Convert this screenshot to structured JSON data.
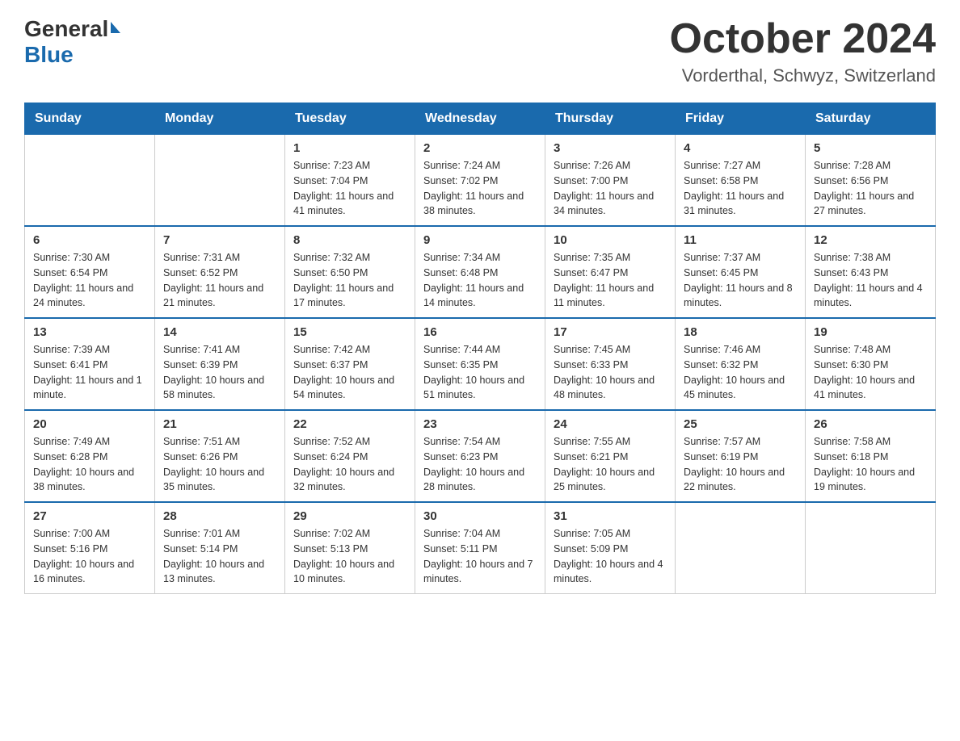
{
  "header": {
    "logo_general": "General",
    "logo_blue": "Blue",
    "month_title": "October 2024",
    "location": "Vorderthal, Schwyz, Switzerland"
  },
  "weekdays": [
    "Sunday",
    "Monday",
    "Tuesday",
    "Wednesday",
    "Thursday",
    "Friday",
    "Saturday"
  ],
  "weeks": [
    [
      {
        "day": "",
        "sunrise": "",
        "sunset": "",
        "daylight": ""
      },
      {
        "day": "",
        "sunrise": "",
        "sunset": "",
        "daylight": ""
      },
      {
        "day": "1",
        "sunrise": "Sunrise: 7:23 AM",
        "sunset": "Sunset: 7:04 PM",
        "daylight": "Daylight: 11 hours and 41 minutes."
      },
      {
        "day": "2",
        "sunrise": "Sunrise: 7:24 AM",
        "sunset": "Sunset: 7:02 PM",
        "daylight": "Daylight: 11 hours and 38 minutes."
      },
      {
        "day": "3",
        "sunrise": "Sunrise: 7:26 AM",
        "sunset": "Sunset: 7:00 PM",
        "daylight": "Daylight: 11 hours and 34 minutes."
      },
      {
        "day": "4",
        "sunrise": "Sunrise: 7:27 AM",
        "sunset": "Sunset: 6:58 PM",
        "daylight": "Daylight: 11 hours and 31 minutes."
      },
      {
        "day": "5",
        "sunrise": "Sunrise: 7:28 AM",
        "sunset": "Sunset: 6:56 PM",
        "daylight": "Daylight: 11 hours and 27 minutes."
      }
    ],
    [
      {
        "day": "6",
        "sunrise": "Sunrise: 7:30 AM",
        "sunset": "Sunset: 6:54 PM",
        "daylight": "Daylight: 11 hours and 24 minutes."
      },
      {
        "day": "7",
        "sunrise": "Sunrise: 7:31 AM",
        "sunset": "Sunset: 6:52 PM",
        "daylight": "Daylight: 11 hours and 21 minutes."
      },
      {
        "day": "8",
        "sunrise": "Sunrise: 7:32 AM",
        "sunset": "Sunset: 6:50 PM",
        "daylight": "Daylight: 11 hours and 17 minutes."
      },
      {
        "day": "9",
        "sunrise": "Sunrise: 7:34 AM",
        "sunset": "Sunset: 6:48 PM",
        "daylight": "Daylight: 11 hours and 14 minutes."
      },
      {
        "day": "10",
        "sunrise": "Sunrise: 7:35 AM",
        "sunset": "Sunset: 6:47 PM",
        "daylight": "Daylight: 11 hours and 11 minutes."
      },
      {
        "day": "11",
        "sunrise": "Sunrise: 7:37 AM",
        "sunset": "Sunset: 6:45 PM",
        "daylight": "Daylight: 11 hours and 8 minutes."
      },
      {
        "day": "12",
        "sunrise": "Sunrise: 7:38 AM",
        "sunset": "Sunset: 6:43 PM",
        "daylight": "Daylight: 11 hours and 4 minutes."
      }
    ],
    [
      {
        "day": "13",
        "sunrise": "Sunrise: 7:39 AM",
        "sunset": "Sunset: 6:41 PM",
        "daylight": "Daylight: 11 hours and 1 minute."
      },
      {
        "day": "14",
        "sunrise": "Sunrise: 7:41 AM",
        "sunset": "Sunset: 6:39 PM",
        "daylight": "Daylight: 10 hours and 58 minutes."
      },
      {
        "day": "15",
        "sunrise": "Sunrise: 7:42 AM",
        "sunset": "Sunset: 6:37 PM",
        "daylight": "Daylight: 10 hours and 54 minutes."
      },
      {
        "day": "16",
        "sunrise": "Sunrise: 7:44 AM",
        "sunset": "Sunset: 6:35 PM",
        "daylight": "Daylight: 10 hours and 51 minutes."
      },
      {
        "day": "17",
        "sunrise": "Sunrise: 7:45 AM",
        "sunset": "Sunset: 6:33 PM",
        "daylight": "Daylight: 10 hours and 48 minutes."
      },
      {
        "day": "18",
        "sunrise": "Sunrise: 7:46 AM",
        "sunset": "Sunset: 6:32 PM",
        "daylight": "Daylight: 10 hours and 45 minutes."
      },
      {
        "day": "19",
        "sunrise": "Sunrise: 7:48 AM",
        "sunset": "Sunset: 6:30 PM",
        "daylight": "Daylight: 10 hours and 41 minutes."
      }
    ],
    [
      {
        "day": "20",
        "sunrise": "Sunrise: 7:49 AM",
        "sunset": "Sunset: 6:28 PM",
        "daylight": "Daylight: 10 hours and 38 minutes."
      },
      {
        "day": "21",
        "sunrise": "Sunrise: 7:51 AM",
        "sunset": "Sunset: 6:26 PM",
        "daylight": "Daylight: 10 hours and 35 minutes."
      },
      {
        "day": "22",
        "sunrise": "Sunrise: 7:52 AM",
        "sunset": "Sunset: 6:24 PM",
        "daylight": "Daylight: 10 hours and 32 minutes."
      },
      {
        "day": "23",
        "sunrise": "Sunrise: 7:54 AM",
        "sunset": "Sunset: 6:23 PM",
        "daylight": "Daylight: 10 hours and 28 minutes."
      },
      {
        "day": "24",
        "sunrise": "Sunrise: 7:55 AM",
        "sunset": "Sunset: 6:21 PM",
        "daylight": "Daylight: 10 hours and 25 minutes."
      },
      {
        "day": "25",
        "sunrise": "Sunrise: 7:57 AM",
        "sunset": "Sunset: 6:19 PM",
        "daylight": "Daylight: 10 hours and 22 minutes."
      },
      {
        "day": "26",
        "sunrise": "Sunrise: 7:58 AM",
        "sunset": "Sunset: 6:18 PM",
        "daylight": "Daylight: 10 hours and 19 minutes."
      }
    ],
    [
      {
        "day": "27",
        "sunrise": "Sunrise: 7:00 AM",
        "sunset": "Sunset: 5:16 PM",
        "daylight": "Daylight: 10 hours and 16 minutes."
      },
      {
        "day": "28",
        "sunrise": "Sunrise: 7:01 AM",
        "sunset": "Sunset: 5:14 PM",
        "daylight": "Daylight: 10 hours and 13 minutes."
      },
      {
        "day": "29",
        "sunrise": "Sunrise: 7:02 AM",
        "sunset": "Sunset: 5:13 PM",
        "daylight": "Daylight: 10 hours and 10 minutes."
      },
      {
        "day": "30",
        "sunrise": "Sunrise: 7:04 AM",
        "sunset": "Sunset: 5:11 PM",
        "daylight": "Daylight: 10 hours and 7 minutes."
      },
      {
        "day": "31",
        "sunrise": "Sunrise: 7:05 AM",
        "sunset": "Sunset: 5:09 PM",
        "daylight": "Daylight: 10 hours and 4 minutes."
      },
      {
        "day": "",
        "sunrise": "",
        "sunset": "",
        "daylight": ""
      },
      {
        "day": "",
        "sunrise": "",
        "sunset": "",
        "daylight": ""
      }
    ]
  ]
}
